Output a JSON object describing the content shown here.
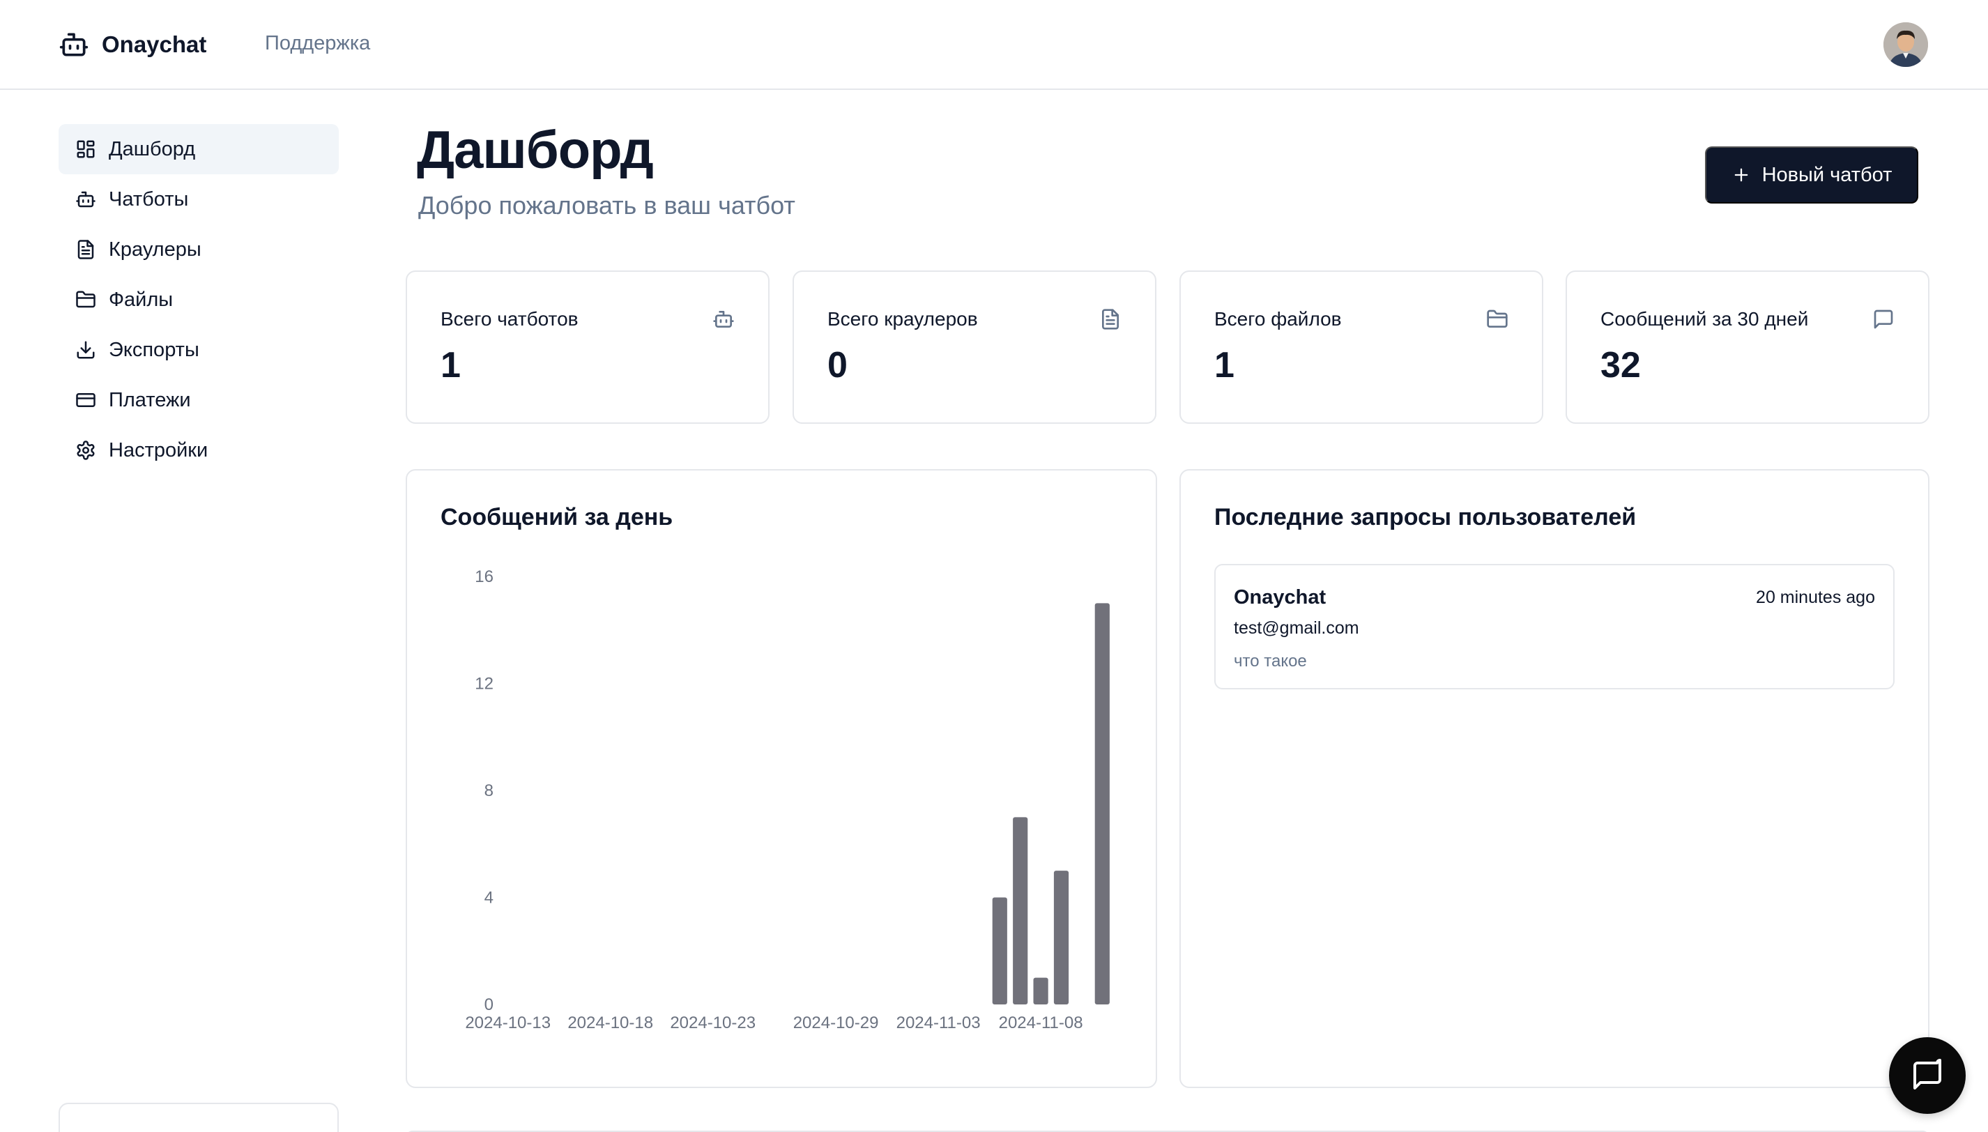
{
  "header": {
    "brand": "Onaychat",
    "support_link": "Поддержка"
  },
  "sidebar": {
    "items": [
      {
        "label": "Дашборд",
        "icon": "dashboard-icon",
        "active": true
      },
      {
        "label": "Чатботы",
        "icon": "bot-icon"
      },
      {
        "label": "Краулеры",
        "icon": "file-text-icon"
      },
      {
        "label": "Файлы",
        "icon": "folder-icon"
      },
      {
        "label": "Экспорты",
        "icon": "download-icon"
      },
      {
        "label": "Платежи",
        "icon": "credit-card-icon"
      },
      {
        "label": "Настройки",
        "icon": "gear-icon"
      }
    ]
  },
  "page": {
    "title": "Дашборд",
    "subtitle": "Добро пожаловать в ваш чатбот",
    "new_button": "Новый чатбот"
  },
  "stats": [
    {
      "label": "Всего чатботов",
      "value": "1",
      "icon": "bot-icon"
    },
    {
      "label": "Всего краулеров",
      "value": "0",
      "icon": "file-text-icon"
    },
    {
      "label": "Всего файлов",
      "value": "1",
      "icon": "folder-icon"
    },
    {
      "label": "Сообщений за 30 дней",
      "value": "32",
      "icon": "message-square-icon"
    }
  ],
  "chart_panel": {
    "title": "Сообщений за день"
  },
  "chart_data": {
    "type": "bar",
    "title": "Сообщений за день",
    "xlabel": "",
    "ylabel": "",
    "ylim": [
      0,
      16
    ],
    "y_ticks": [
      0,
      4,
      8,
      12,
      16
    ],
    "x_tick_labels": [
      "2024-10-13",
      "2024-10-18",
      "2024-10-23",
      "2024-10-29",
      "2024-11-03",
      "2024-11-08"
    ],
    "x": [
      "2024-10-13",
      "2024-10-14",
      "2024-10-15",
      "2024-10-16",
      "2024-10-17",
      "2024-10-18",
      "2024-10-19",
      "2024-10-20",
      "2024-10-21",
      "2024-10-22",
      "2024-10-23",
      "2024-10-24",
      "2024-10-25",
      "2024-10-26",
      "2024-10-27",
      "2024-10-28",
      "2024-10-29",
      "2024-10-30",
      "2024-10-31",
      "2024-11-01",
      "2024-11-02",
      "2024-11-03",
      "2024-11-04",
      "2024-11-05",
      "2024-11-06",
      "2024-11-07",
      "2024-11-08",
      "2024-11-09",
      "2024-11-10",
      "2024-11-11"
    ],
    "values": [
      0,
      0,
      0,
      0,
      0,
      0,
      0,
      0,
      0,
      0,
      0,
      0,
      0,
      0,
      0,
      0,
      0,
      0,
      0,
      0,
      0,
      0,
      0,
      0,
      4,
      7,
      1,
      5,
      0,
      15
    ],
    "bar_color": "#71717a",
    "grid": false
  },
  "requests_panel": {
    "title": "Последние запросы пользователей",
    "items": [
      {
        "name": "Onaychat",
        "time": "20 minutes ago",
        "email": "test@gmail.com",
        "text": "что такое"
      }
    ]
  }
}
